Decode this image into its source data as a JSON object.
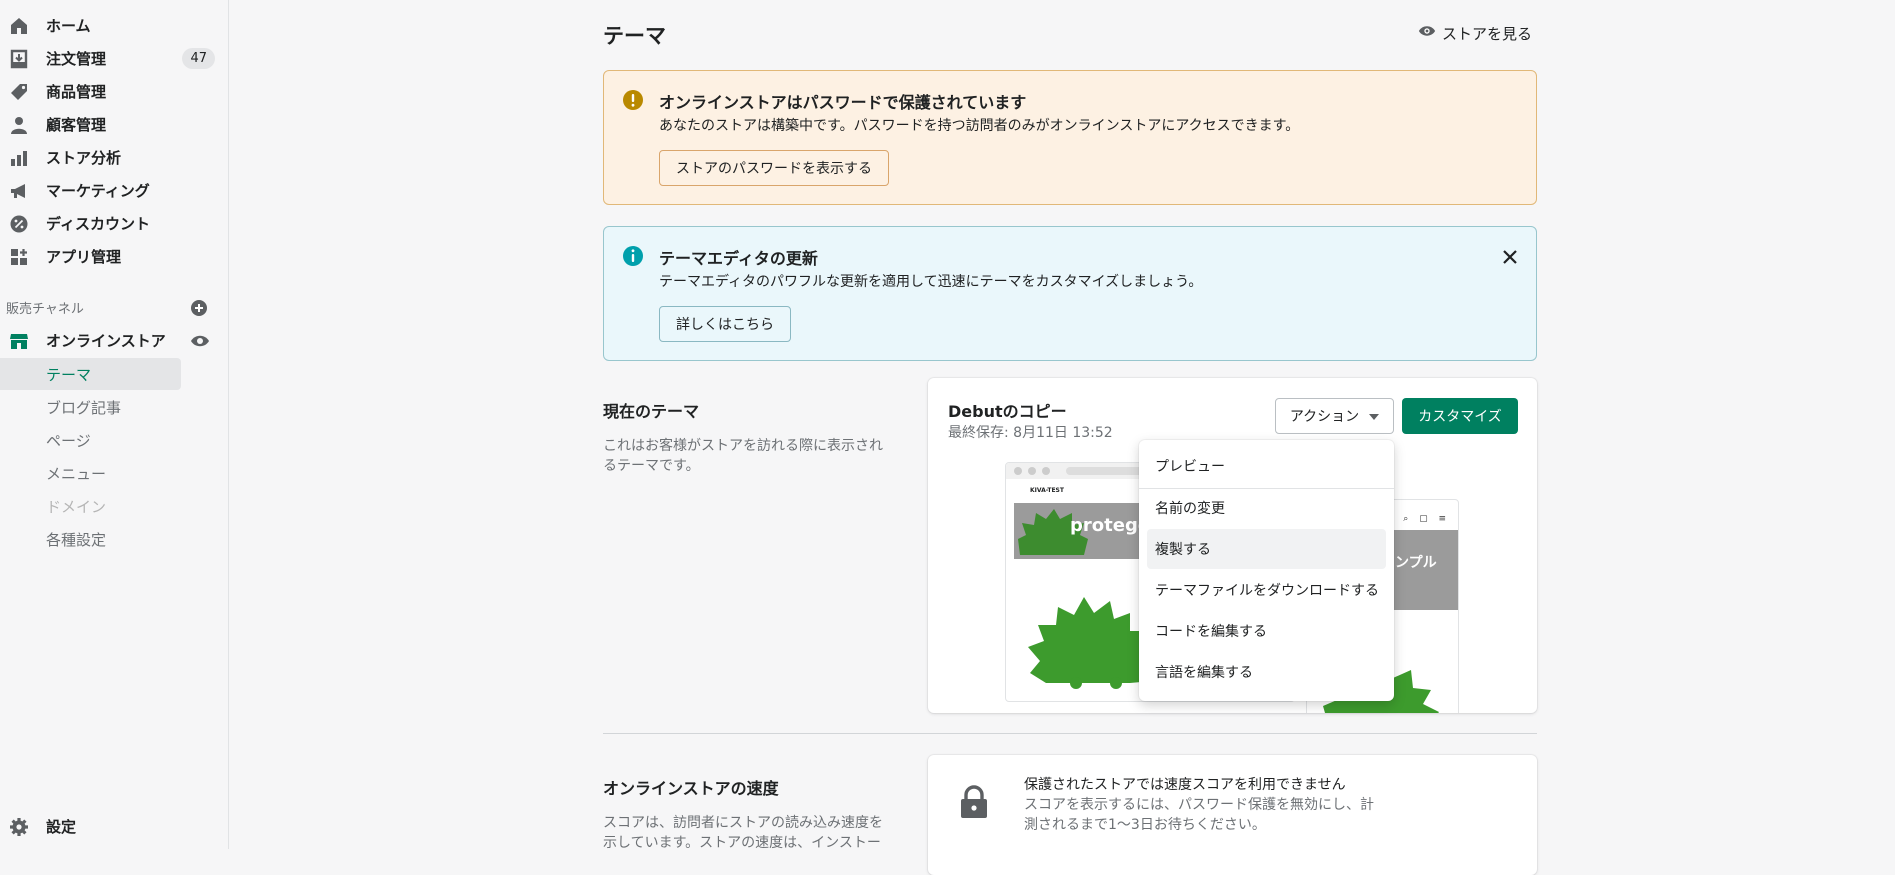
{
  "sidebar": {
    "items": [
      {
        "label": "ホーム",
        "icon": "home-icon"
      },
      {
        "label": "注文管理",
        "icon": "orders-icon",
        "badge": "47"
      },
      {
        "label": "商品管理",
        "icon": "tag-icon"
      },
      {
        "label": "顧客管理",
        "icon": "customer-icon"
      },
      {
        "label": "ストア分析",
        "icon": "analytics-icon"
      },
      {
        "label": "マーケティング",
        "icon": "megaphone-icon"
      },
      {
        "label": "ディスカウント",
        "icon": "discount-icon"
      },
      {
        "label": "アプリ管理",
        "icon": "apps-icon"
      }
    ],
    "channels_label": "販売チャネル",
    "online_store": "オンラインストア",
    "sub_items": [
      "テーマ",
      "ブログ記事",
      "ページ",
      "メニュー",
      "ドメイン",
      "各種設定"
    ],
    "settings": "設定"
  },
  "header": {
    "title": "テーマ",
    "view_store": "ストアを見る"
  },
  "password_banner": {
    "title": "オンラインストアはパスワードで保護されています",
    "text": "あなたのストアは構築中です。パスワードを持つ訪問者のみがオンラインストアにアクセスできます。",
    "button": "ストアのパスワードを表示する"
  },
  "editor_banner": {
    "title": "テーマエディタの更新",
    "text": "テーマエディタのパワフルな更新を適用して迅速にテーマをカスタマイズしましょう。",
    "button": "詳しくはこちら"
  },
  "current_theme": {
    "heading": "現在のテーマ",
    "description": "これはお客様がストアを訪れる際に表示されるテーマです。",
    "name": "Debutのコピー",
    "last_saved": "最終保存: 8月11日 13:52",
    "action_label": "アクション",
    "customize_label": "カスタマイズ",
    "preview": {
      "store_name": "KIVA-TEST",
      "hero_text": "proteger",
      "mobile_text": "ンプル"
    }
  },
  "action_menu": [
    "プレビュー",
    "名前の変更",
    "複製する",
    "テーマファイルをダウンロードする",
    "コードを編集する",
    "言語を編集する"
  ],
  "speed": {
    "heading": "オンラインストアの速度",
    "description": "スコアは、訪問者にストアの読み込み速度を示しています。ストアの速度は、インストー",
    "card_title": "保護されたストアでは速度スコアを利用できません",
    "card_text": "スコアを表示するには、パスワード保護を無効にし、計測されるまで1〜3日お待ちください。"
  },
  "colors": {
    "accent": "#008060",
    "warning": "#b98900",
    "info": "#00a0ac"
  }
}
